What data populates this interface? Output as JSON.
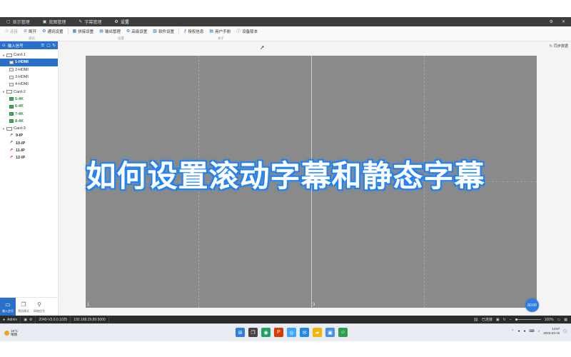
{
  "tabs": [
    {
      "icon": "▢",
      "label": "显示管理"
    },
    {
      "icon": "▣",
      "label": "底图管理"
    },
    {
      "icon": "✎",
      "label": "字幕管理"
    },
    {
      "icon": "⚙",
      "label": "设置"
    }
  ],
  "window_controls": {
    "settings": "⚙",
    "close": "✕"
  },
  "toolbar": {
    "items": [
      {
        "icon": "⊘",
        "label": "连接",
        "disabled": true
      },
      {
        "icon": "⊘",
        "label": "断开",
        "disabled": false
      },
      {
        "icon": "⚙",
        "label": "通讯设置",
        "disabled": false
      },
      {
        "icon": "▦",
        "label": "拼接设置",
        "disabled": false
      },
      {
        "icon": "▤",
        "label": "输出管理",
        "disabled": false
      },
      {
        "icon": "⚙",
        "label": "高级设置",
        "disabled": false
      },
      {
        "icon": "▧",
        "label": "软件设置",
        "disabled": false
      },
      {
        "icon": "⚷",
        "label": "授权信息",
        "disabled": false
      },
      {
        "icon": "▤",
        "label": "用户手册",
        "disabled": false
      },
      {
        "icon": "ⓘ",
        "label": "设备版本",
        "disabled": false
      }
    ],
    "groups": [
      "通讯",
      "设置",
      "关于"
    ]
  },
  "sidebar": {
    "header": "输入信号",
    "cards": [
      {
        "name": "Card-1",
        "inputs": [
          {
            "label": "1-HDMI",
            "type": "hdmi",
            "selected": true
          },
          {
            "label": "2-HDMI",
            "type": "hdmi",
            "selected": false
          },
          {
            "label": "3-HDMI",
            "type": "hdmi",
            "selected": false
          },
          {
            "label": "4-HDMI",
            "type": "hdmi",
            "selected": false
          }
        ]
      },
      {
        "name": "Card-2",
        "inputs": [
          {
            "label": "5-4K",
            "type": "k4",
            "selected": false
          },
          {
            "label": "6-4K",
            "type": "k4",
            "selected": false
          },
          {
            "label": "7-4K",
            "type": "k4",
            "selected": false
          },
          {
            "label": "8-4K",
            "type": "k4",
            "selected": false
          }
        ]
      },
      {
        "name": "Card-3",
        "inputs": [
          {
            "label": "9-IP",
            "type": "ip",
            "selected": false
          },
          {
            "label": "10-IP",
            "type": "ip",
            "selected": false
          },
          {
            "label": "11-IP",
            "type": "ip",
            "selected": false
          },
          {
            "label": "12-IP",
            "type": "ip",
            "selected": false
          }
        ]
      }
    ],
    "bottom_buttons": [
      {
        "icon": "▭",
        "label": "输入信号",
        "active": true
      },
      {
        "icon": "❐",
        "label": "预览模式",
        "active": false
      },
      {
        "icon": "⚲",
        "label": "网络信号",
        "active": false
      }
    ]
  },
  "main": {
    "sync_label": "同步数据",
    "screen_numbers": [
      "1",
      "3"
    ],
    "fab_label": "60:00"
  },
  "overlay_title": "如何设置滚动字幕和静态字幕",
  "statusbar": {
    "user": "Admin",
    "version": "2040-V3.0.0.1025",
    "address": "192.168.29.89:5000",
    "connection": "已连接",
    "zoom": "100%"
  },
  "taskbar": {
    "weather_temp": "18°C",
    "weather_text": "晴朗",
    "time": "14:57",
    "date": "2023-03-15"
  }
}
